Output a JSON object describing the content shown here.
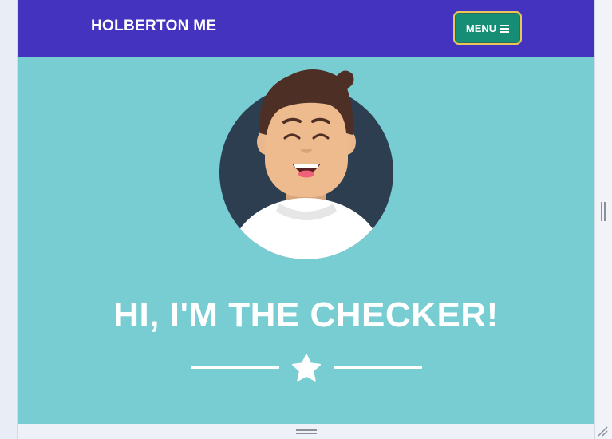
{
  "navbar": {
    "brand": "HOLBERTON ME",
    "menu_label": "MENU",
    "menu_icon": "hamburger-icon"
  },
  "hero": {
    "avatar_icon": "avatar-illustration",
    "title": "HI, I'M THE CHECKER!",
    "divider_icon": "star-icon"
  },
  "colors": {
    "navbar_bg": "#4333be",
    "page_bg": "#78cdd2",
    "menu_button_bg": "#168e76",
    "menu_button_border": "#e9c65a"
  }
}
